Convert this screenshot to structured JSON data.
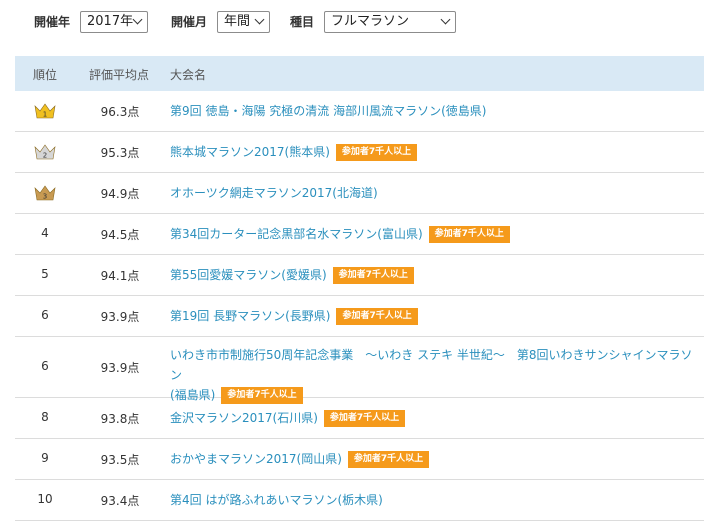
{
  "filters": {
    "year_label": "開催年",
    "year_value": "2017年",
    "month_label": "開催月",
    "month_value": "年間",
    "type_label": "種目",
    "type_value": "フルマラソン"
  },
  "table": {
    "headers": {
      "rank": "順位",
      "score": "評価平均点",
      "name": "大会名"
    },
    "badge_text": "参加者7千人以上",
    "crown_colors": {
      "gold": "#f0c020",
      "silver": "#d6d6d6",
      "bronze": "#c89a52"
    },
    "rows": [
      {
        "rank": "1",
        "score": "96.3点",
        "name": "第9回 徳島・海陽 究極の清流 海部川風流マラソン(徳島県)",
        "name2": "",
        "badge": false,
        "crown": "gold"
      },
      {
        "rank": "2",
        "score": "95.3点",
        "name": "熊本城マラソン2017(熊本県)",
        "name2": "",
        "badge": true,
        "crown": "silver"
      },
      {
        "rank": "3",
        "score": "94.9点",
        "name": "オホーツク網走マラソン2017(北海道)",
        "name2": "",
        "badge": false,
        "crown": "bronze"
      },
      {
        "rank": "4",
        "score": "94.5点",
        "name": "第34回カーター記念黒部名水マラソン(富山県)",
        "name2": "",
        "badge": true,
        "crown": ""
      },
      {
        "rank": "5",
        "score": "94.1点",
        "name": "第55回愛媛マラソン(愛媛県)",
        "name2": "",
        "badge": true,
        "crown": ""
      },
      {
        "rank": "6",
        "score": "93.9点",
        "name": "第19回 長野マラソン(長野県)",
        "name2": "",
        "badge": true,
        "crown": ""
      },
      {
        "rank": "6",
        "score": "93.9点",
        "name": "いわき市市制施行50周年記念事業　～いわき ステキ 半世紀～　第8回いわきサンシャインマラソン",
        "name2": "(福島県)",
        "badge": true,
        "crown": ""
      },
      {
        "rank": "8",
        "score": "93.8点",
        "name": "金沢マラソン2017(石川県)",
        "name2": "",
        "badge": true,
        "crown": ""
      },
      {
        "rank": "9",
        "score": "93.5点",
        "name": "おかやまマラソン2017(岡山県)",
        "name2": "",
        "badge": true,
        "crown": ""
      },
      {
        "rank": "10",
        "score": "93.4点",
        "name": "第4回 はが路ふれあいマラソン(栃木県)",
        "name2": "",
        "badge": false,
        "crown": ""
      }
    ]
  }
}
